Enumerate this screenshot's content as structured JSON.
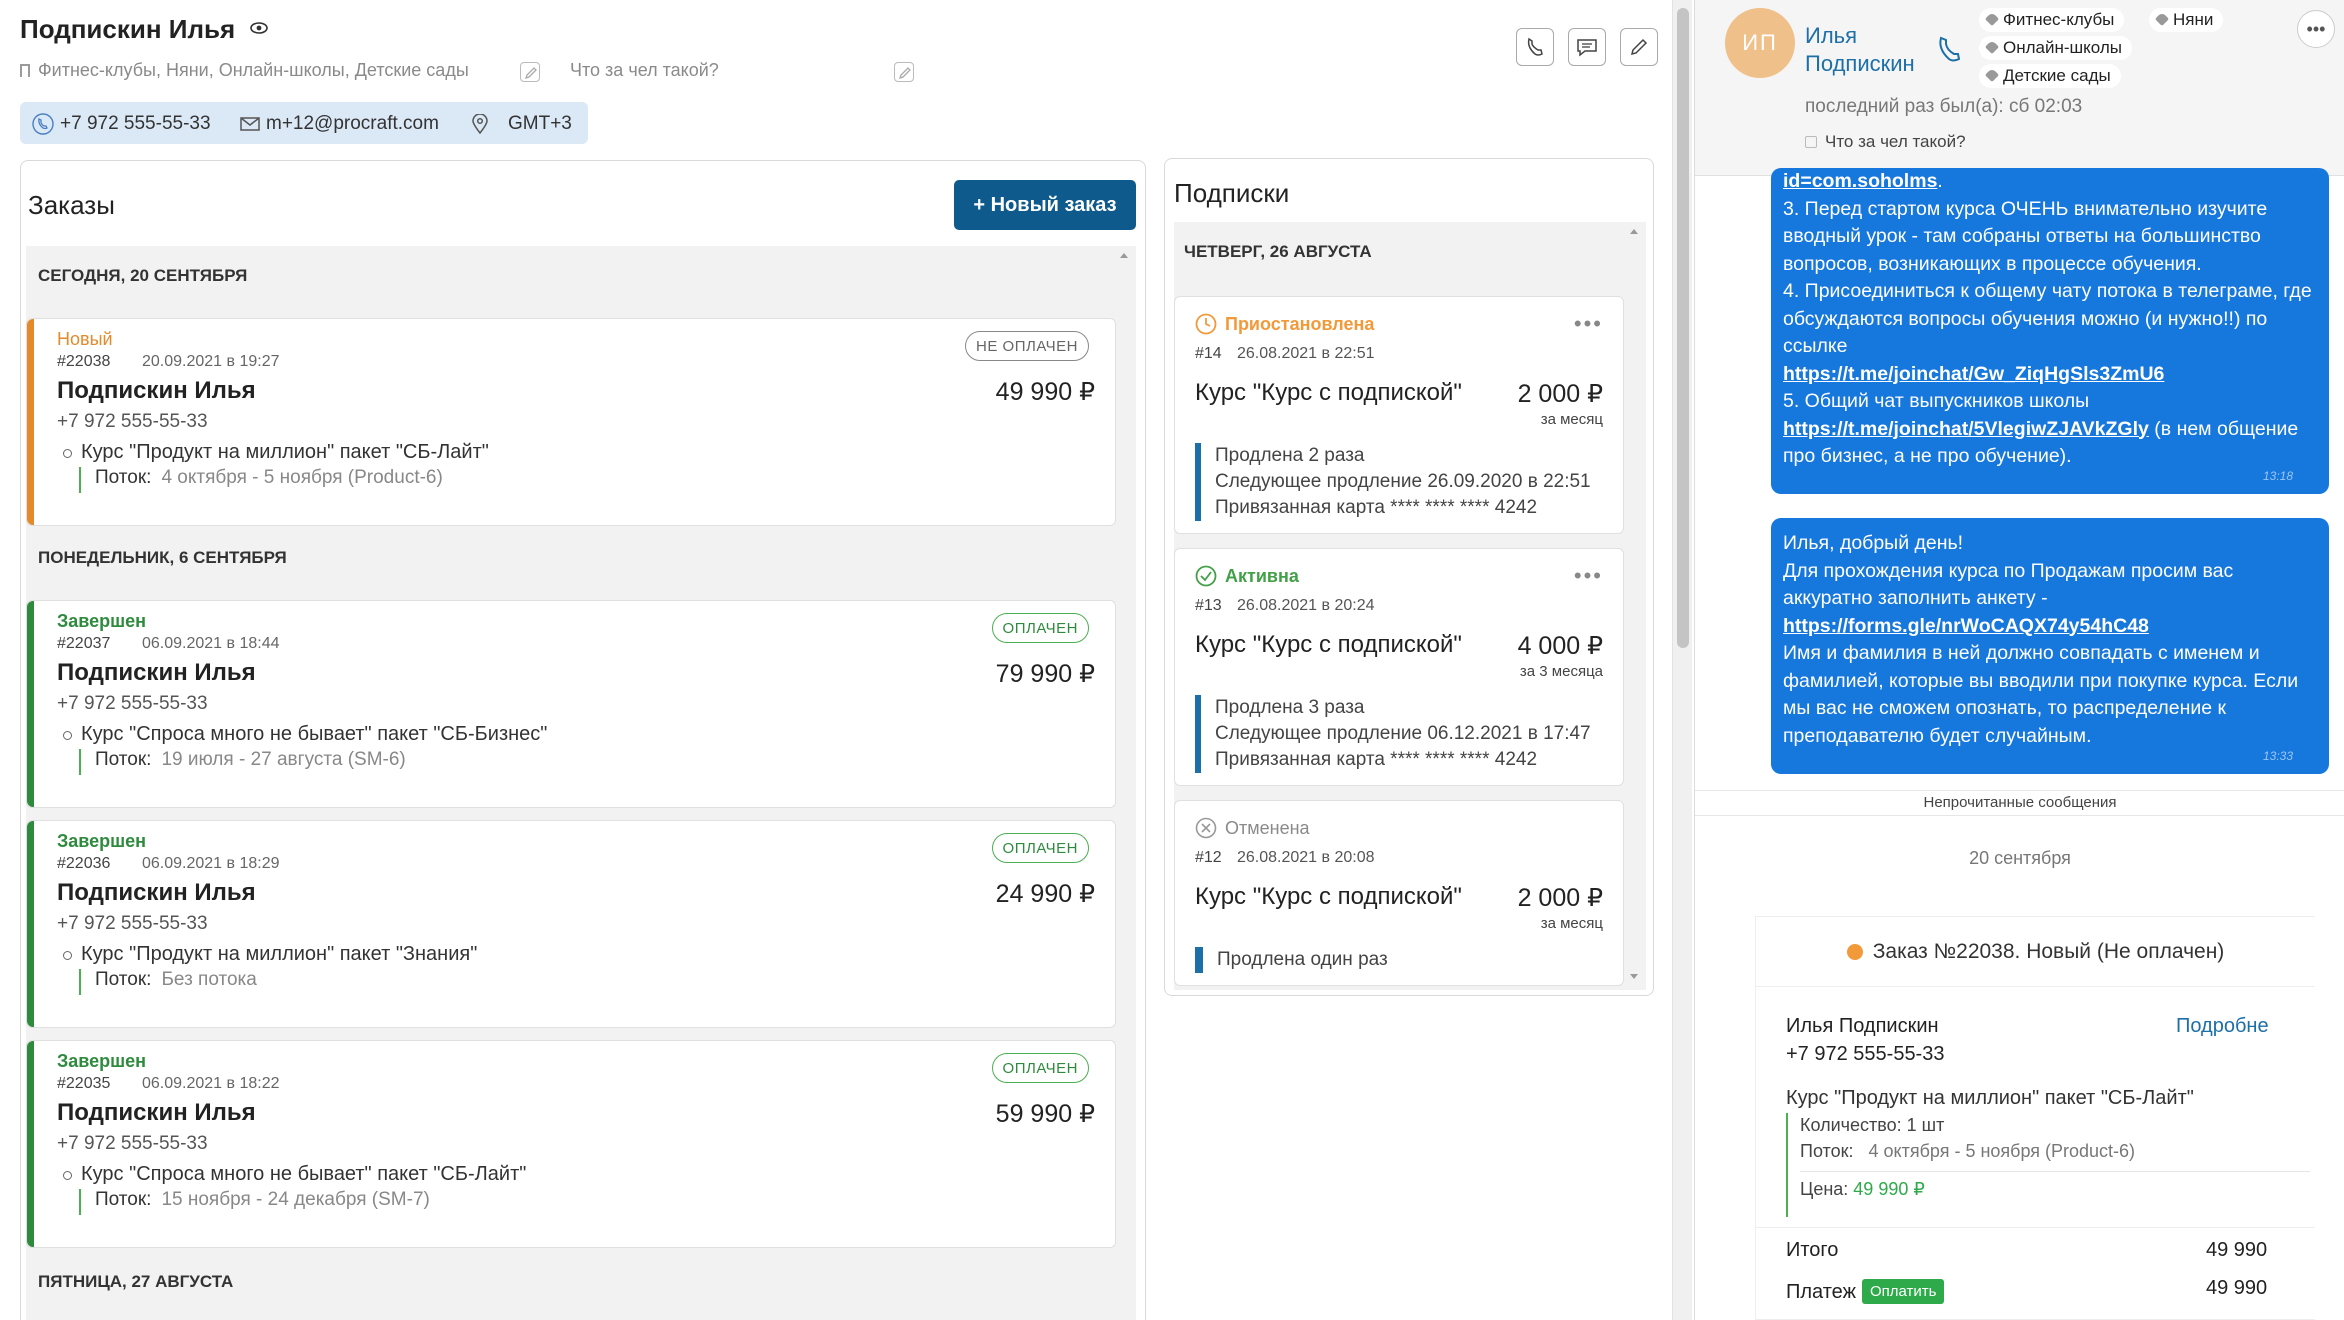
{
  "header": {
    "name": "Подпискин Илья",
    "tags": "Фитнес-клубы, Няни, Онлайн-школы, Детские сады",
    "who_placeholder": "Что за чел такой?",
    "phone": "+7 972 555-55-33",
    "email": "m+12@procraft.com",
    "timezone": "GMT+3"
  },
  "orders": {
    "title": "Заказы",
    "new_button": "+ Новый заказ",
    "days": [
      "СЕГОДНЯ, 20 СЕНТЯБРЯ",
      "ПОНЕДЕЛЬНИК, 6 СЕНТЯБРЯ",
      "ПЯТНИЦА, 27 АВГУСТА"
    ],
    "flow_label": "Поток:",
    "items": [
      {
        "status": "Новый",
        "status_color": "#e38a2b",
        "num": "#22038",
        "date": "20.09.2021 в 19:27",
        "name": "Подпискин Илья",
        "phone": "+7 972 555-55-33",
        "course": "Курс \"Продукт на миллион\" пакет \"СБ-Лайт\"",
        "flow": "4 октября - 5 ноября (Product-6)",
        "badge": "НЕ ОПЛАЧЕН",
        "badge_color": "#777777",
        "amount": "49 990 ₽"
      },
      {
        "status": "Завершен",
        "status_color": "#2e8b3d",
        "num": "#22037",
        "date": "06.09.2021 в 18:44",
        "name": "Подпискин Илья",
        "phone": "+7 972 555-55-33",
        "course": "Курс \"Спроса много не бывает\" пакет \"СБ-Бизнес\"",
        "flow": "19 июля - 27 августа (SM-6)",
        "badge": "ОПЛАЧЕН",
        "badge_color": "#2e8b3d",
        "amount": "79 990 ₽"
      },
      {
        "status": "Завершен",
        "status_color": "#2e8b3d",
        "num": "#22036",
        "date": "06.09.2021 в 18:29",
        "name": "Подпискин Илья",
        "phone": "+7 972 555-55-33",
        "course": "Курс \"Продукт на миллион\" пакет \"Знания\"",
        "flow": "Без потока",
        "badge": "ОПЛАЧЕН",
        "badge_color": "#2e8b3d",
        "amount": "24 990 ₽"
      },
      {
        "status": "Завершен",
        "status_color": "#2e8b3d",
        "num": "#22035",
        "date": "06.09.2021 в 18:22",
        "name": "Подпискин Илья",
        "phone": "+7 972 555-55-33",
        "course": "Курс \"Спроса много не бывает\" пакет \"СБ-Лайт\"",
        "flow": "15 ноября - 24 декабря (SM-7)",
        "badge": "ОПЛАЧЕН",
        "badge_color": "#2e8b3d",
        "amount": "59 990 ₽"
      }
    ]
  },
  "subscriptions": {
    "title": "Подписки",
    "day": "ЧЕТВЕРГ, 26 АВГУСТА",
    "items": [
      {
        "status": "Приостановлена",
        "status_color": "#f29a3a",
        "icon": "clock-icon",
        "num": "#14",
        "date": "26.08.2021 в 22:51",
        "title": "Курс \"Курс с подпиской\"",
        "amount": "2 000 ₽",
        "period": "за месяц",
        "renewed": "Продлена 2 раза",
        "next": "Следующее продление 26.09.2020 в 22:51",
        "card": "Привязанная карта **** **** **** 4242"
      },
      {
        "status": "Активна",
        "status_color": "#43a047",
        "icon": "check-circle-icon",
        "num": "#13",
        "date": "26.08.2021 в 20:24",
        "title": "Курс \"Курс с подпиской\"",
        "amount": "4 000 ₽",
        "period": "за 3 месяца",
        "renewed": "Продлена 3 раза",
        "next": "Следующее продление 06.12.2021 в 17:47",
        "card": "Привязанная карта **** **** **** 4242"
      },
      {
        "status": "Отменена",
        "status_color": "#8a8a8a",
        "icon": "x-circle-icon",
        "num": "#12",
        "date": "26.08.2021 в 20:08",
        "title": "Курс \"Курс с подпиской\"",
        "amount": "2 000 ₽",
        "period": "за месяц",
        "renewed": "Продлена один раз"
      }
    ]
  },
  "chat": {
    "initials": "ИП",
    "name_line1": "Илья",
    "name_line2": "Подпискин",
    "tags": [
      "Фитнес-клубы",
      "Няни",
      "Онлайн-школы",
      "Детские сады"
    ],
    "last_seen": "последний раз был(а): сб 02:03",
    "who": "Что за чел такой?",
    "menu": "•••",
    "msg1": {
      "link0": "id=com.soholms",
      "p3": "3. Перед стартом курса ОЧЕНЬ внимательно изучите вводный урок - там собраны ответы на большинство вопросов, возникающих в процессе обучения.",
      "p4": "4. Присоединиться к общему чату потока в телеграме, где обсуждаются вопросы обучения можно (и нужно!!) по ссылке",
      "link4": "https://t.me/joinchat/Gw_ZiqHgSls3ZmU6",
      "p5": "5. Общий чат выпускников школы",
      "link5": "https://t.me/joinchat/5VlegiwZJAVkZGly",
      "p5b": "(в нем общение про бизнес, а не про обучение).",
      "time": "13:18"
    },
    "msg2": {
      "l1": "Илья, добрый день!",
      "l2": "Для прохождения курса по Продажам просим вас аккуратно заполнить анкету -",
      "link": "https://forms.gle/nrWoCAQX74y54hC48",
      "l3": "Имя и фамилия в ней должно совпадать с именем и фамилией, которые вы вводили при покупке курса. Если мы вас не сможем опознать, то распределение к преподавателю будет случайным.",
      "time": "13:33"
    },
    "unread": "Непрочитанные сообщения",
    "day": "20 сентября",
    "order": {
      "title": "Заказ №22038. Новый (Не оплачен)",
      "client": "Илья Подпискин",
      "details": "Подробне",
      "phone": "+7 972 555-55-33",
      "course": "Курс \"Продукт на миллион\" пакет \"СБ-Лайт\"",
      "qty": "Количество: 1 шт",
      "flow_label": "Поток:",
      "flow": "4 октября - 5 ноября (Product-6)",
      "price_label": "Цена:",
      "price": "49 990 ₽",
      "total_label": "Итого",
      "total": "49 990",
      "payment_label": "Платеж",
      "pay_button": "Оплатить",
      "payment": "49 990"
    }
  }
}
